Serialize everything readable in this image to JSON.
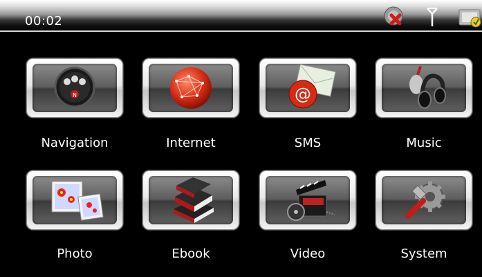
{
  "status_bar": {
    "time": "00:02",
    "icons": [
      "gps-disconnected-icon",
      "signal-antenna-icon",
      "battery-charging-icon"
    ]
  },
  "menu": {
    "items": [
      {
        "label": "Navigation",
        "icon": "steering-wheel-icon"
      },
      {
        "label": "Internet",
        "icon": "globe-icon"
      },
      {
        "label": "SMS",
        "icon": "envelope-at-icon"
      },
      {
        "label": "Music",
        "icon": "headphones-guitar-icon"
      },
      {
        "label": "Photo",
        "icon": "photos-icon"
      },
      {
        "label": "Ebook",
        "icon": "books-icon"
      },
      {
        "label": "Video",
        "icon": "clapperboard-film-icon"
      },
      {
        "label": "System",
        "icon": "gear-wrench-icon"
      }
    ]
  }
}
